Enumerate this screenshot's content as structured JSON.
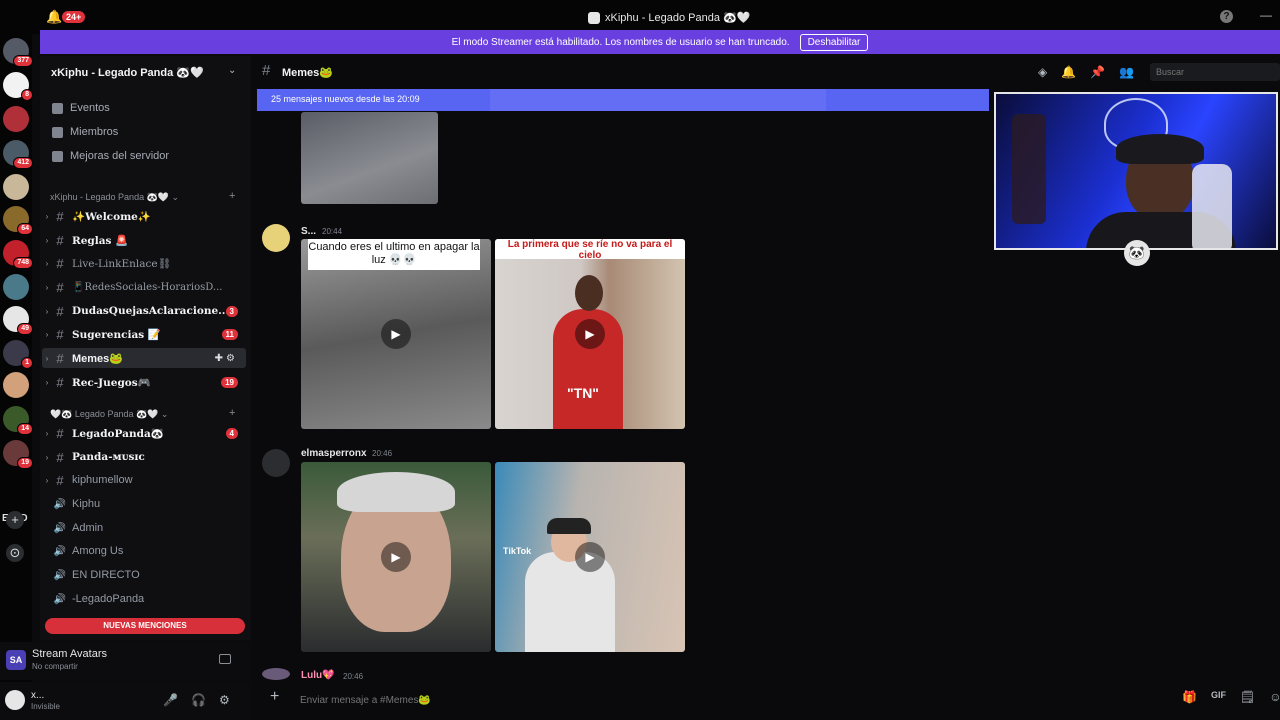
{
  "window": {
    "title": "xKiphu - Legado Panda 🐼🤍",
    "notification_count": "24+",
    "help": "?",
    "minimize": "—"
  },
  "streamer_banner": {
    "text": "El modo Streamer está habilitado. Los nombres de usuario se han truncado.",
    "button": "Deshabilitar"
  },
  "servers": [
    {
      "badge": "377",
      "color": "#555b66"
    },
    {
      "badge": "8",
      "color": "#f2f2f2"
    },
    {
      "badge": "",
      "color": "#b0303a"
    },
    {
      "badge": "412",
      "color": "#4a5a66"
    },
    {
      "badge": "",
      "color": "#c9b79a"
    },
    {
      "badge": "64",
      "color": "#8a6a2a"
    },
    {
      "badge": "748",
      "color": "#c2202b"
    },
    {
      "badge": "",
      "color": "#4a7a8a"
    },
    {
      "badge": "49",
      "color": "#e6e6e6"
    },
    {
      "badge": "1",
      "color": "#3a3a4a"
    },
    {
      "badge": "",
      "color": "#d2a07a"
    },
    {
      "badge": "14",
      "color": "#3a5a2a"
    },
    {
      "badge": "19",
      "color": "#6a3a3a"
    }
  ],
  "server_text": "EsdD",
  "server_add": "+",
  "server_explore": "⊙",
  "guild": {
    "name": "xKiphu - Legado Panda 🐼🤍",
    "chevron": "⌄",
    "nav": [
      {
        "label": "Eventos"
      },
      {
        "label": "Miembros"
      },
      {
        "label": "Mejoras del servidor"
      }
    ]
  },
  "categories": [
    {
      "label": "xKiphu - Legado Panda 🐼🤍 ⌄"
    },
    {
      "label": "🤍🐼 Legado Panda 🐼🤍 ⌄"
    }
  ],
  "channels": [
    {
      "label": "✨Welcome✨",
      "count": ""
    },
    {
      "label": "Reglas 🚨",
      "count": ""
    },
    {
      "label": "Live-LinkEnlace⛓",
      "count": ""
    },
    {
      "label": "📱RedesSociales-HorariosD...",
      "count": ""
    },
    {
      "label": "DudasQuejasAclaracione...",
      "count": "3"
    },
    {
      "label": "Sugerencias 📝",
      "count": "11"
    },
    {
      "label": "Memes🐸",
      "count": ""
    },
    {
      "label": "Rec-Juegos🎮",
      "count": "19"
    },
    {
      "label": "LegadoPanda🐼",
      "count": "4"
    },
    {
      "label": "Panda-ᴍᴜsɪᴄ",
      "count": ""
    },
    {
      "label": "kiphumellow",
      "count": ""
    }
  ],
  "voice_channels": [
    {
      "label": "Kiphu"
    },
    {
      "label": "Admin"
    },
    {
      "label": "Among Us"
    },
    {
      "label": "EN DIRECTO"
    },
    {
      "label": "-LegadoPanda"
    }
  ],
  "mentions_pill": "NUEVAS MENCIONES",
  "activity": {
    "avatar_text": "SA",
    "name": "Stream Avatars",
    "sub": "No compartir"
  },
  "user": {
    "name": "x...",
    "status": "Invisible"
  },
  "header": {
    "channel": "Memes🐸",
    "search_placeholder": "Buscar"
  },
  "new_messages_bar": "25 mensajes nuevos desde las 20:09",
  "messages": [
    {
      "author": "S...",
      "time": "20:44",
      "captions": [
        "Cuando eres el ultimo en apagar la luz 💀💀",
        "La primera que se ríe no va para el cielo"
      ],
      "overlay": "\"TN\""
    },
    {
      "author": "elmasperronx",
      "time": "20:46",
      "watermark": "TikTok"
    },
    {
      "author": "Lulu💖",
      "time": "20:46"
    }
  ],
  "composer": {
    "placeholder": "Enviar mensaje a #Memes🐸"
  },
  "icons": {
    "bell": "🔔",
    "header": [
      "◈",
      "🔔",
      "📌",
      "👥"
    ],
    "composer": [
      "🎁",
      "GIF",
      "🗒",
      "☺"
    ],
    "user_controls": [
      "🎤",
      "🎧",
      "⚙"
    ],
    "play": "▶"
  }
}
